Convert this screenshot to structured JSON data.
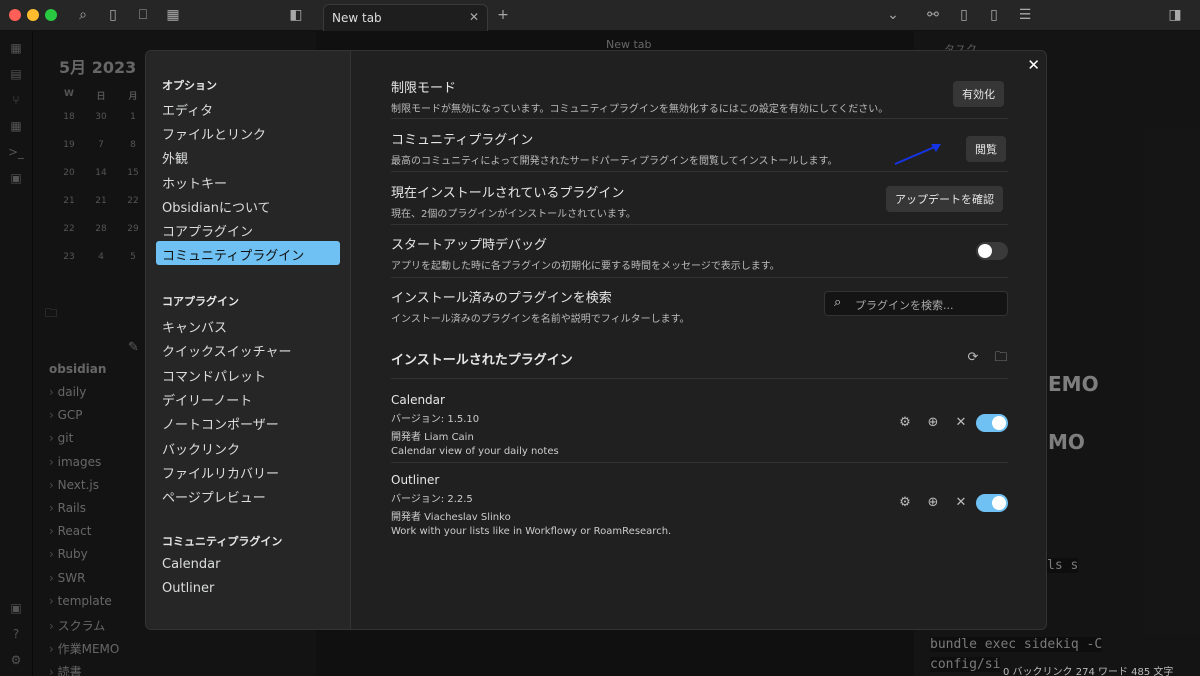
{
  "titlebar": {
    "tab_title": "New tab",
    "mid_tab_title": "New tab"
  },
  "colors": {
    "accent": "#6ec1f2",
    "toggle_on": "#6ec1f2",
    "highlight_box": "#1534e6"
  },
  "calendar": {
    "title": "5月 2023",
    "weekdays": [
      "W",
      "日",
      "月"
    ],
    "weeks": [
      [
        "18",
        "30",
        "1"
      ],
      [
        "19",
        "7",
        "8"
      ],
      [
        "20",
        "14",
        "15"
      ],
      [
        "21",
        "21",
        "22"
      ],
      [
        "22",
        "28",
        "29"
      ],
      [
        "23",
        "4",
        "5"
      ]
    ]
  },
  "filetree": {
    "root": "obsidian",
    "items": [
      "daily",
      "GCP",
      "git",
      "images",
      "Next.js",
      "Rails",
      "React",
      "Ruby",
      "SWR",
      "template",
      "スクラム",
      "作業MEMO",
      "読書"
    ]
  },
  "rightpane": {
    "title": "タスク",
    "big1": "EMO",
    "big2": "MO",
    "code1": "ls s",
    "code2": "bundle exec sidekiq -C",
    "code3": "config/si",
    "status": "0 バックリンク  274 ワード  485 文字"
  },
  "settings": {
    "sidebar": {
      "options_header": "オプション",
      "options": [
        "エディタ",
        "ファイルとリンク",
        "外観",
        "ホットキー",
        "Obsidianについて",
        "コアプラグイン",
        "コミュニティプラグイン"
      ],
      "core_header": "コアプラグイン",
      "core": [
        "キャンバス",
        "クイックスイッチャー",
        "コマンドパレット",
        "デイリーノート",
        "ノートコンポーザー",
        "バックリンク",
        "ファイルリカバリー",
        "ページプレビュー"
      ],
      "community_header": "コミュニティプラグイン",
      "community": [
        "Calendar",
        "Outliner"
      ]
    },
    "rows": {
      "restricted": {
        "name": "制限モード",
        "desc": "制限モードが無効になっています。コミュニティプラグインを無効化するにはこの設定を有効にしてください。",
        "button": "有効化"
      },
      "community": {
        "name": "コミュニティプラグイン",
        "desc": "最高のコミュニティによって開発されたサードパーティプラグインを閲覧してインストールします。",
        "button": "閲覧"
      },
      "installed": {
        "name": "現在インストールされているプラグイン",
        "desc": "現在、2個のプラグインがインストールされています。",
        "button": "アップデートを確認"
      },
      "debug": {
        "name": "スタートアップ時デバッグ",
        "desc": "アプリを起動した時に各プラグインの初期化に要する時間をメッセージで表示します。"
      },
      "search": {
        "name": "インストール済みのプラグインを検索",
        "desc": "インストール済みのプラグインを名前や説明でフィルターします。",
        "placeholder": "プラグインを検索..."
      }
    },
    "installed_header": "インストールされたプラグイン",
    "plugins": [
      {
        "name": "Calendar",
        "version": "バージョン: 1.5.10",
        "author": "開発者 Liam Cain",
        "desc": "Calendar view of your daily notes"
      },
      {
        "name": "Outliner",
        "version": "バージョン: 2.2.5",
        "author": "開発者 Viacheslav Slinko",
        "desc": "Work with your lists like in Workflowy or RoamResearch."
      }
    ]
  }
}
